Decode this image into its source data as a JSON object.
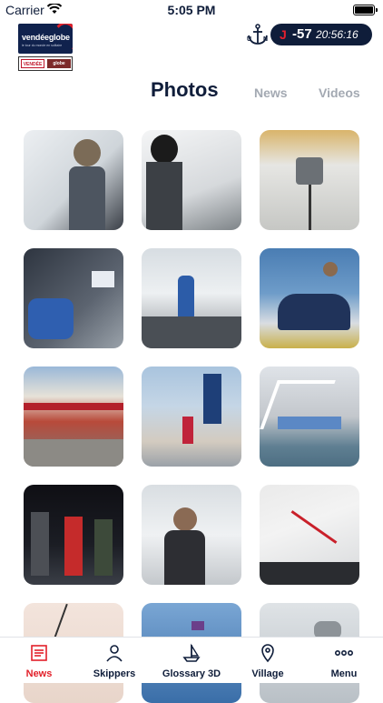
{
  "status_bar": {
    "carrier": "Carrier",
    "time": "5:05 PM"
  },
  "header": {
    "logo_text": "vendéeglobe",
    "logo_subtitle": "le tour du monde en solitaire",
    "sponsor_left": "VENDÉE",
    "sponsor_right": "globe",
    "countdown_prefix": "J",
    "countdown_days": "-57",
    "countdown_clock": "20:56:16"
  },
  "tabs": {
    "active": "Photos",
    "news": "News",
    "videos": "Videos"
  },
  "photos": [
    {
      "id": "p1",
      "caption_icon": "crew-at-work"
    },
    {
      "id": "p2",
      "caption_icon": "sailor-on-deck"
    },
    {
      "id": "p3",
      "caption_icon": "boat-interior"
    },
    {
      "id": "p4",
      "caption_icon": "skipper-cockpit"
    },
    {
      "id": "p5",
      "caption_icon": "sailor-at-helm"
    },
    {
      "id": "p6",
      "caption_icon": "sailor-sail"
    },
    {
      "id": "p7",
      "caption_icon": "street-shops"
    },
    {
      "id": "p8",
      "caption_icon": "banners-street"
    },
    {
      "id": "p9",
      "caption_icon": "harbour-bridge"
    },
    {
      "id": "p10",
      "caption_icon": "night-crowd"
    },
    {
      "id": "p11",
      "caption_icon": "skipper-fist"
    },
    {
      "id": "p12",
      "caption_icon": "hull-sail"
    },
    {
      "id": "p13",
      "caption_icon": "rigging"
    },
    {
      "id": "p14",
      "caption_icon": "sea"
    },
    {
      "id": "p15",
      "caption_icon": "boat"
    }
  ],
  "tabbar": [
    {
      "label": "News",
      "icon": "news-list-icon",
      "active": true
    },
    {
      "label": "Skippers",
      "icon": "person-icon",
      "active": false
    },
    {
      "label": "Glossary 3D",
      "icon": "boat-icon",
      "active": false
    },
    {
      "label": "Village",
      "icon": "map-pin-icon",
      "active": false
    },
    {
      "label": "Menu",
      "icon": "more-dots-icon",
      "active": false
    }
  ],
  "colors": {
    "navy": "#0f1d3a",
    "red": "#e2202a",
    "gray_tab": "#a3a9b2"
  }
}
